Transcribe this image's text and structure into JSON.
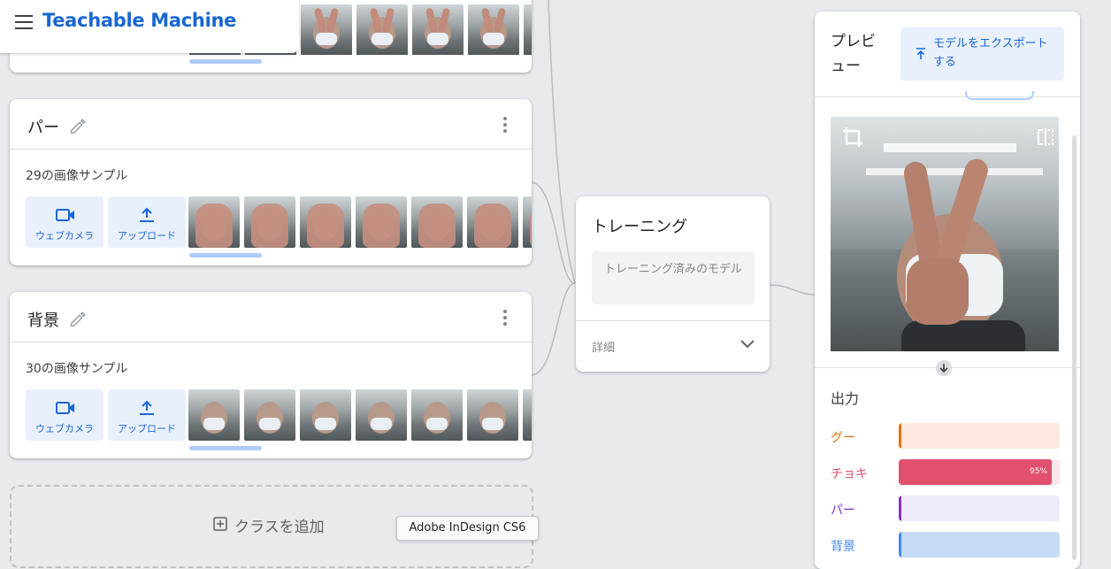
{
  "app": {
    "title": "Teachable Machine"
  },
  "classes": [
    {
      "name": "パー",
      "sample_count": "29の画像サンプル",
      "webcam_label": "ウェブカメラ",
      "upload_label": "アップロード",
      "thumb_kind": "palm"
    },
    {
      "name": "背景",
      "sample_count": "30の画像サンプル",
      "webcam_label": "ウェブカメラ",
      "upload_label": "アップロード",
      "thumb_kind": "mask"
    }
  ],
  "add_class": {
    "label": "クラスを追加"
  },
  "tooltip": {
    "text": "Adobe InDesign CS6"
  },
  "training": {
    "title": "トレーニング",
    "trained_button": "トレーニング済みのモデル",
    "details_label": "詳細"
  },
  "preview": {
    "title": "プレビュー",
    "export_button": "モデルをエクスポートする",
    "output_title": "出力",
    "outputs": [
      {
        "label": "グー",
        "percent": 0,
        "color": "#e8710a",
        "track": "#fde9df"
      },
      {
        "label": "チョキ",
        "percent": 95,
        "percent_label": "95%",
        "color": "#e1506c",
        "track": "#fde7ea"
      },
      {
        "label": "パー",
        "percent": 0,
        "color": "#8430ce",
        "track": "#efeaf9"
      },
      {
        "label": "背景",
        "percent": 0,
        "color": "#4285f4",
        "track": "#c6d9f5"
      }
    ]
  },
  "icons": {
    "menu": "menu-icon",
    "edit": "pencil-icon",
    "more": "more-vert-icon",
    "webcam": "videocam-icon",
    "upload": "upload-icon",
    "crop": "crop-icon",
    "flip": "flip-icon",
    "expand": "chevron-down-icon",
    "download": "arrow-down-icon",
    "add": "add-box-icon",
    "export": "export-icon"
  }
}
